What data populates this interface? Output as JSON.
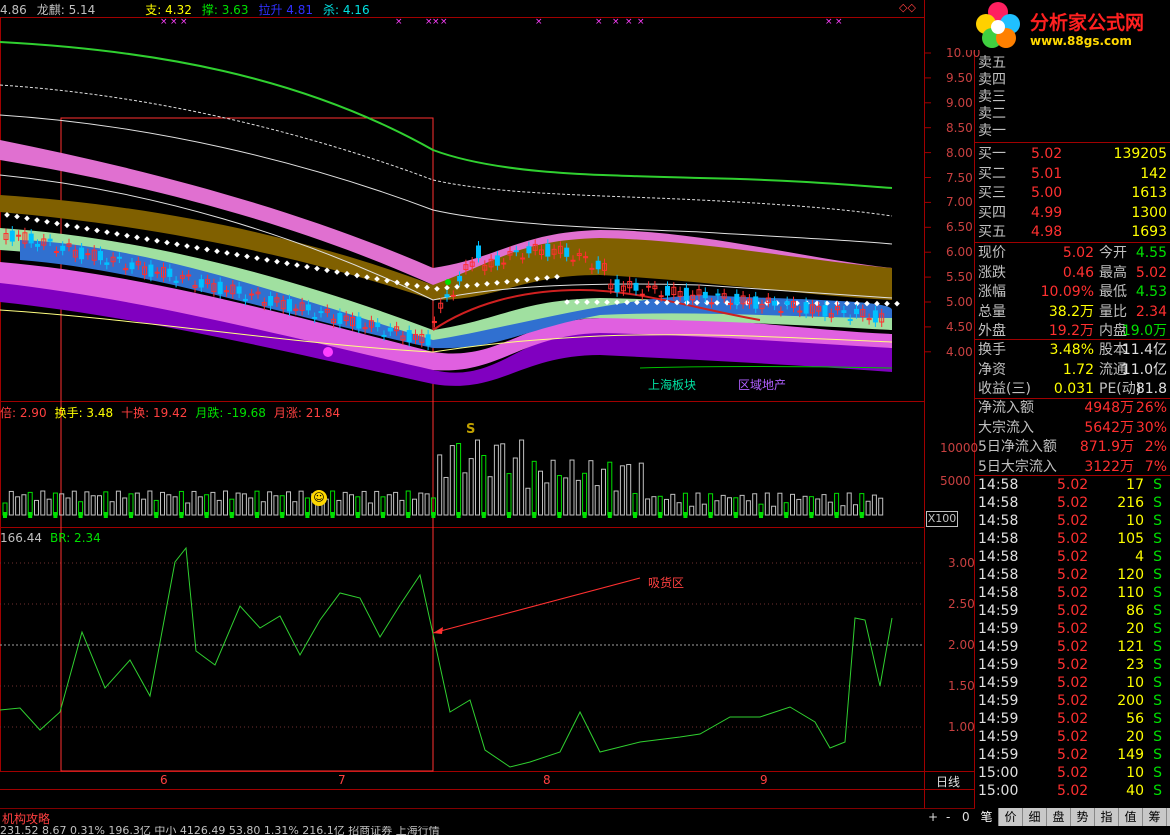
{
  "top_info": [
    {
      "text": "4.86",
      "color": "#c0c0c0"
    },
    {
      "text": "龙麒: 5.14",
      "color": "#c0c0c0"
    },
    {
      "text": "支: 4.32",
      "color": "#ffff00"
    },
    {
      "text": "撑: 3.63",
      "color": "#00e000"
    },
    {
      "text": "拉升 4.81",
      "color": "#3030ff"
    },
    {
      "text": "杀: 4.16",
      "color": "#00e0e0"
    }
  ],
  "logo": {
    "title": "分析家公式网",
    "url": "www.88gs.com"
  },
  "price_axis": [
    "10.00",
    "9.50",
    "9.00",
    "8.50",
    "8.00",
    "7.50",
    "7.00",
    "6.50",
    "6.00",
    "5.50",
    "5.00",
    "4.50",
    "4.00"
  ],
  "volume_axis": [
    "10000",
    "5000"
  ],
  "volume_unit": "X100",
  "br_axis": [
    "3.00",
    "2.50",
    "2.00",
    "1.50",
    "1.00"
  ],
  "date_labels": [
    "6",
    "7",
    "8",
    "9"
  ],
  "period_label": "日线",
  "zoom_controls": [
    "+",
    "-",
    "0"
  ],
  "chart_labels": {
    "sector1": "上海板块",
    "sector2": "区域地产",
    "annotation": "吸货区"
  },
  "volume_header": [
    {
      "text": "倍: 2.90",
      "color": "#ff4040"
    },
    {
      "text": "换手: 3.48",
      "color": "#ffff00"
    },
    {
      "text": "十换: 19.42",
      "color": "#ff4040"
    },
    {
      "text": "月跌: -19.68",
      "color": "#00e000"
    },
    {
      "text": "月涨: 21.84",
      "color": "#ff4040"
    }
  ],
  "br_header": [
    {
      "text": "166.44",
      "color": "#c0c0c0"
    },
    {
      "text": "BR: 2.34",
      "color": "#00e000"
    }
  ],
  "volume_marker": "S",
  "sell_orders": [
    {
      "label": "卖五"
    },
    {
      "label": "卖四"
    },
    {
      "label": "卖三"
    },
    {
      "label": "卖二"
    },
    {
      "label": "卖一"
    }
  ],
  "buy_orders": [
    {
      "label": "买一",
      "price": "5.02",
      "vol": "139205"
    },
    {
      "label": "买二",
      "price": "5.01",
      "vol": "142"
    },
    {
      "label": "买三",
      "price": "5.00",
      "vol": "1613"
    },
    {
      "label": "买四",
      "price": "4.99",
      "vol": "1300"
    },
    {
      "label": "买五",
      "price": "4.98",
      "vol": "1693"
    }
  ],
  "quote_stats": [
    {
      "l1": "现价",
      "v1": "5.02",
      "c1": "#ff3030",
      "l2": "今开",
      "v2": "4.55",
      "c2": "#00e000"
    },
    {
      "l1": "涨跌",
      "v1": "0.46",
      "c1": "#ff3030",
      "l2": "最高",
      "v2": "5.02",
      "c2": "#ff3030"
    },
    {
      "l1": "涨幅",
      "v1": "10.09%",
      "c1": "#ff3030",
      "l2": "最低",
      "v2": "4.53",
      "c2": "#00e000"
    },
    {
      "l1": "总量",
      "v1": "38.2万",
      "c1": "#ffff00",
      "l2": "量比",
      "v2": "2.34",
      "c2": "#ff3030"
    },
    {
      "l1": "外盘",
      "v1": "19.2万",
      "c1": "#ff3030",
      "l2": "内盘",
      "v2": "19.0万",
      "c2": "#00e000"
    }
  ],
  "company_stats": [
    {
      "l1": "换手",
      "v1": "3.48%",
      "l2": "股本",
      "v2": "11.4亿"
    },
    {
      "l1": "净资",
      "v1": "1.72",
      "l2": "流通",
      "v2": "11.0亿"
    },
    {
      "l1": "收益(三)",
      "v1": "0.031",
      "l2": "PE(动)",
      "v2": "81.8"
    }
  ],
  "fund_flow": [
    {
      "label": "净流入额",
      "value": "4948万",
      "pct": "26%"
    },
    {
      "label": "大宗流入",
      "value": "5642万",
      "pct": "30%"
    },
    {
      "label": "5日净流入额",
      "value": "871.9万",
      "pct": "2%"
    },
    {
      "label": "5日大宗流入",
      "value": "3122万",
      "pct": "7%"
    }
  ],
  "ticks": [
    {
      "time": "14:58",
      "price": "5.02",
      "vol": "17",
      "side": "S"
    },
    {
      "time": "14:58",
      "price": "5.02",
      "vol": "216",
      "side": "S"
    },
    {
      "time": "14:58",
      "price": "5.02",
      "vol": "10",
      "side": "S"
    },
    {
      "time": "14:58",
      "price": "5.02",
      "vol": "105",
      "side": "S"
    },
    {
      "time": "14:58",
      "price": "5.02",
      "vol": "4",
      "side": "S"
    },
    {
      "time": "14:58",
      "price": "5.02",
      "vol": "120",
      "side": "S"
    },
    {
      "time": "14:58",
      "price": "5.02",
      "vol": "110",
      "side": "S"
    },
    {
      "time": "14:59",
      "price": "5.02",
      "vol": "86",
      "side": "S"
    },
    {
      "time": "14:59",
      "price": "5.02",
      "vol": "20",
      "side": "S"
    },
    {
      "time": "14:59",
      "price": "5.02",
      "vol": "121",
      "side": "S"
    },
    {
      "time": "14:59",
      "price": "5.02",
      "vol": "23",
      "side": "S"
    },
    {
      "time": "14:59",
      "price": "5.02",
      "vol": "10",
      "side": "S"
    },
    {
      "time": "14:59",
      "price": "5.02",
      "vol": "200",
      "side": "S"
    },
    {
      "time": "14:59",
      "price": "5.02",
      "vol": "56",
      "side": "S"
    },
    {
      "time": "14:59",
      "price": "5.02",
      "vol": "20",
      "side": "S"
    },
    {
      "time": "14:59",
      "price": "5.02",
      "vol": "149",
      "side": "S"
    },
    {
      "time": "15:00",
      "price": "5.02",
      "vol": "10",
      "side": "S"
    },
    {
      "time": "15:00",
      "price": "5.02",
      "vol": "40",
      "side": "S"
    }
  ],
  "bottom_tabs": [
    "笔",
    "价",
    "细",
    "盘",
    "势",
    "指",
    "值",
    "筹"
  ],
  "left_bottom_label": "机构攻略",
  "status_text": "231.52  8.67  0.31%  196.3亿  中小 4126.49  53.80  1.31%  216.1亿     招商证券 上海行情",
  "colors": {
    "up": "#ff3030",
    "down": "#00e000",
    "grid": "#800000",
    "frame": "#a00000"
  }
}
